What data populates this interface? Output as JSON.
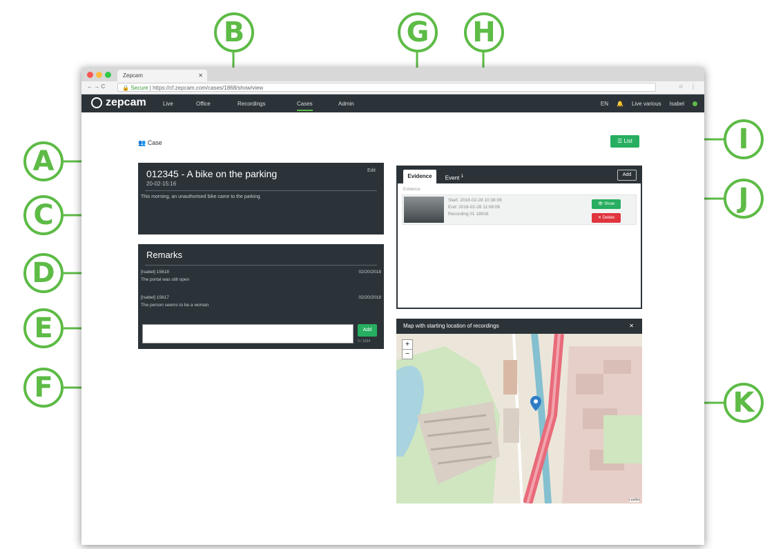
{
  "callouts": [
    "B",
    "G",
    "H",
    "A",
    "C",
    "I",
    "J",
    "D",
    "E",
    "F",
    "K"
  ],
  "browser": {
    "tab_title": "Zepcam",
    "url_secure": "Secure",
    "url": "https://cf.zepcam.com/cases/1868/show/view"
  },
  "app": {
    "logo": "zepcam",
    "nav": [
      "Live",
      "Office",
      "Recordings",
      "Cases",
      "Admin"
    ],
    "right": [
      "EN",
      "Live various",
      "Isabel"
    ]
  },
  "page": {
    "title": "Case",
    "list_button": "List"
  },
  "case": {
    "title": "012345 - A bike on the parking",
    "date": "20-02-15:16",
    "edit": "Edit",
    "description": "This morning, an unauthorised bike came to the parking"
  },
  "remarks": {
    "title": "Remarks",
    "items": [
      {
        "author": "[Isabel] 15618",
        "date": "02/20/2018",
        "text": "The portal was still open"
      },
      {
        "author": "[Isabel] 15617",
        "date": "02/20/2018",
        "text": "The person seems to be a woman"
      }
    ],
    "add_label": "Add",
    "counter": "0 / 1024"
  },
  "evidence": {
    "tabs": [
      "Evidence",
      "Event"
    ],
    "event_badge": "1",
    "add_label": "Add",
    "section": "Evidence",
    "item": {
      "start": "Start: 2018-02-28 10:38:06",
      "end": "End: 2018-02-28 11:08:06",
      "recording": "Recording 01 18916",
      "show_label": "Show",
      "delete_label": "Delete"
    }
  },
  "map": {
    "title": "Map with starting location of recordings",
    "attribution": "Leaflet"
  },
  "colors": {
    "accent": "#5dbb46",
    "dark": "#2c3338",
    "danger": "#e0353f"
  }
}
